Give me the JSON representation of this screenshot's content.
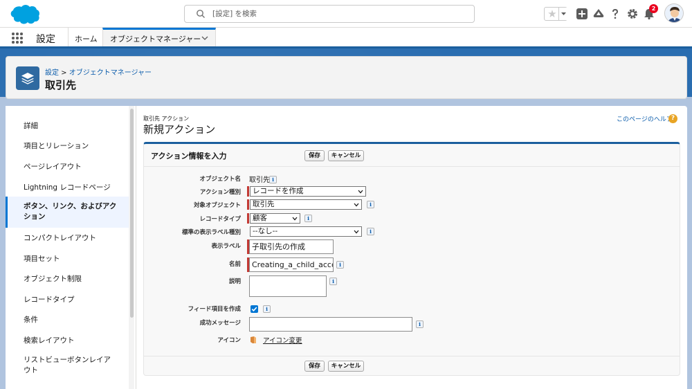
{
  "header": {
    "search_placeholder": "[設定] を検索",
    "notification_count": "2"
  },
  "nav": {
    "app_name": "設定",
    "home": "ホーム",
    "tab": "オブジェクトマネージャー"
  },
  "page_header": {
    "breadcrumb_root": "設定",
    "breadcrumb_sep": " > ",
    "breadcrumb_child": "オブジェクトマネージャー",
    "title": "取引先"
  },
  "sidebar": {
    "items": [
      {
        "label": "詳細"
      },
      {
        "label": "項目とリレーション"
      },
      {
        "label": "ページレイアウト"
      },
      {
        "label": "Lightning レコードページ"
      },
      {
        "label": "ボタン、リンク、およびアクション"
      },
      {
        "label": "コンパクトレイアウト"
      },
      {
        "label": "項目セット"
      },
      {
        "label": "オブジェクト制限"
      },
      {
        "label": "レコードタイプ"
      },
      {
        "label": "条件"
      },
      {
        "label": "検索レイアウト"
      },
      {
        "label": "リストビューボタンレイアウト"
      }
    ]
  },
  "content": {
    "subtitle": "取引先 アクション",
    "title": "新規アクション",
    "help": "このページのヘルプ",
    "section_title": "アクション情報を入力",
    "save": "保存",
    "cancel": "キャンセル"
  },
  "form": {
    "object_label": "オブジェクト名",
    "object_value": "取引先",
    "action_type_label": "アクション種別",
    "action_type_value": "レコードを作成",
    "target_object_label": "対象オブジェクト",
    "target_object_value": "取引先",
    "record_type_label": "レコードタイプ",
    "record_type_value": "顧客",
    "std_label_type_label": "標準の表示ラベル種別",
    "std_label_type_value": "--なし--",
    "display_label_label": "表示ラベル",
    "display_label_value": "子取引先の作成",
    "name_label": "名前",
    "name_value": "Creating_a_child_accou",
    "description_label": "説明",
    "description_value": "",
    "feed_item_label": "フィード項目を作成",
    "success_msg_label": "成功メッセージ",
    "success_msg_value": "",
    "icon_label": "アイコン",
    "icon_change": "アイコン変更"
  },
  "colors": {
    "brand_blue": "#0176d3",
    "header_blue": "#2a6db0",
    "required": "#c23934"
  }
}
